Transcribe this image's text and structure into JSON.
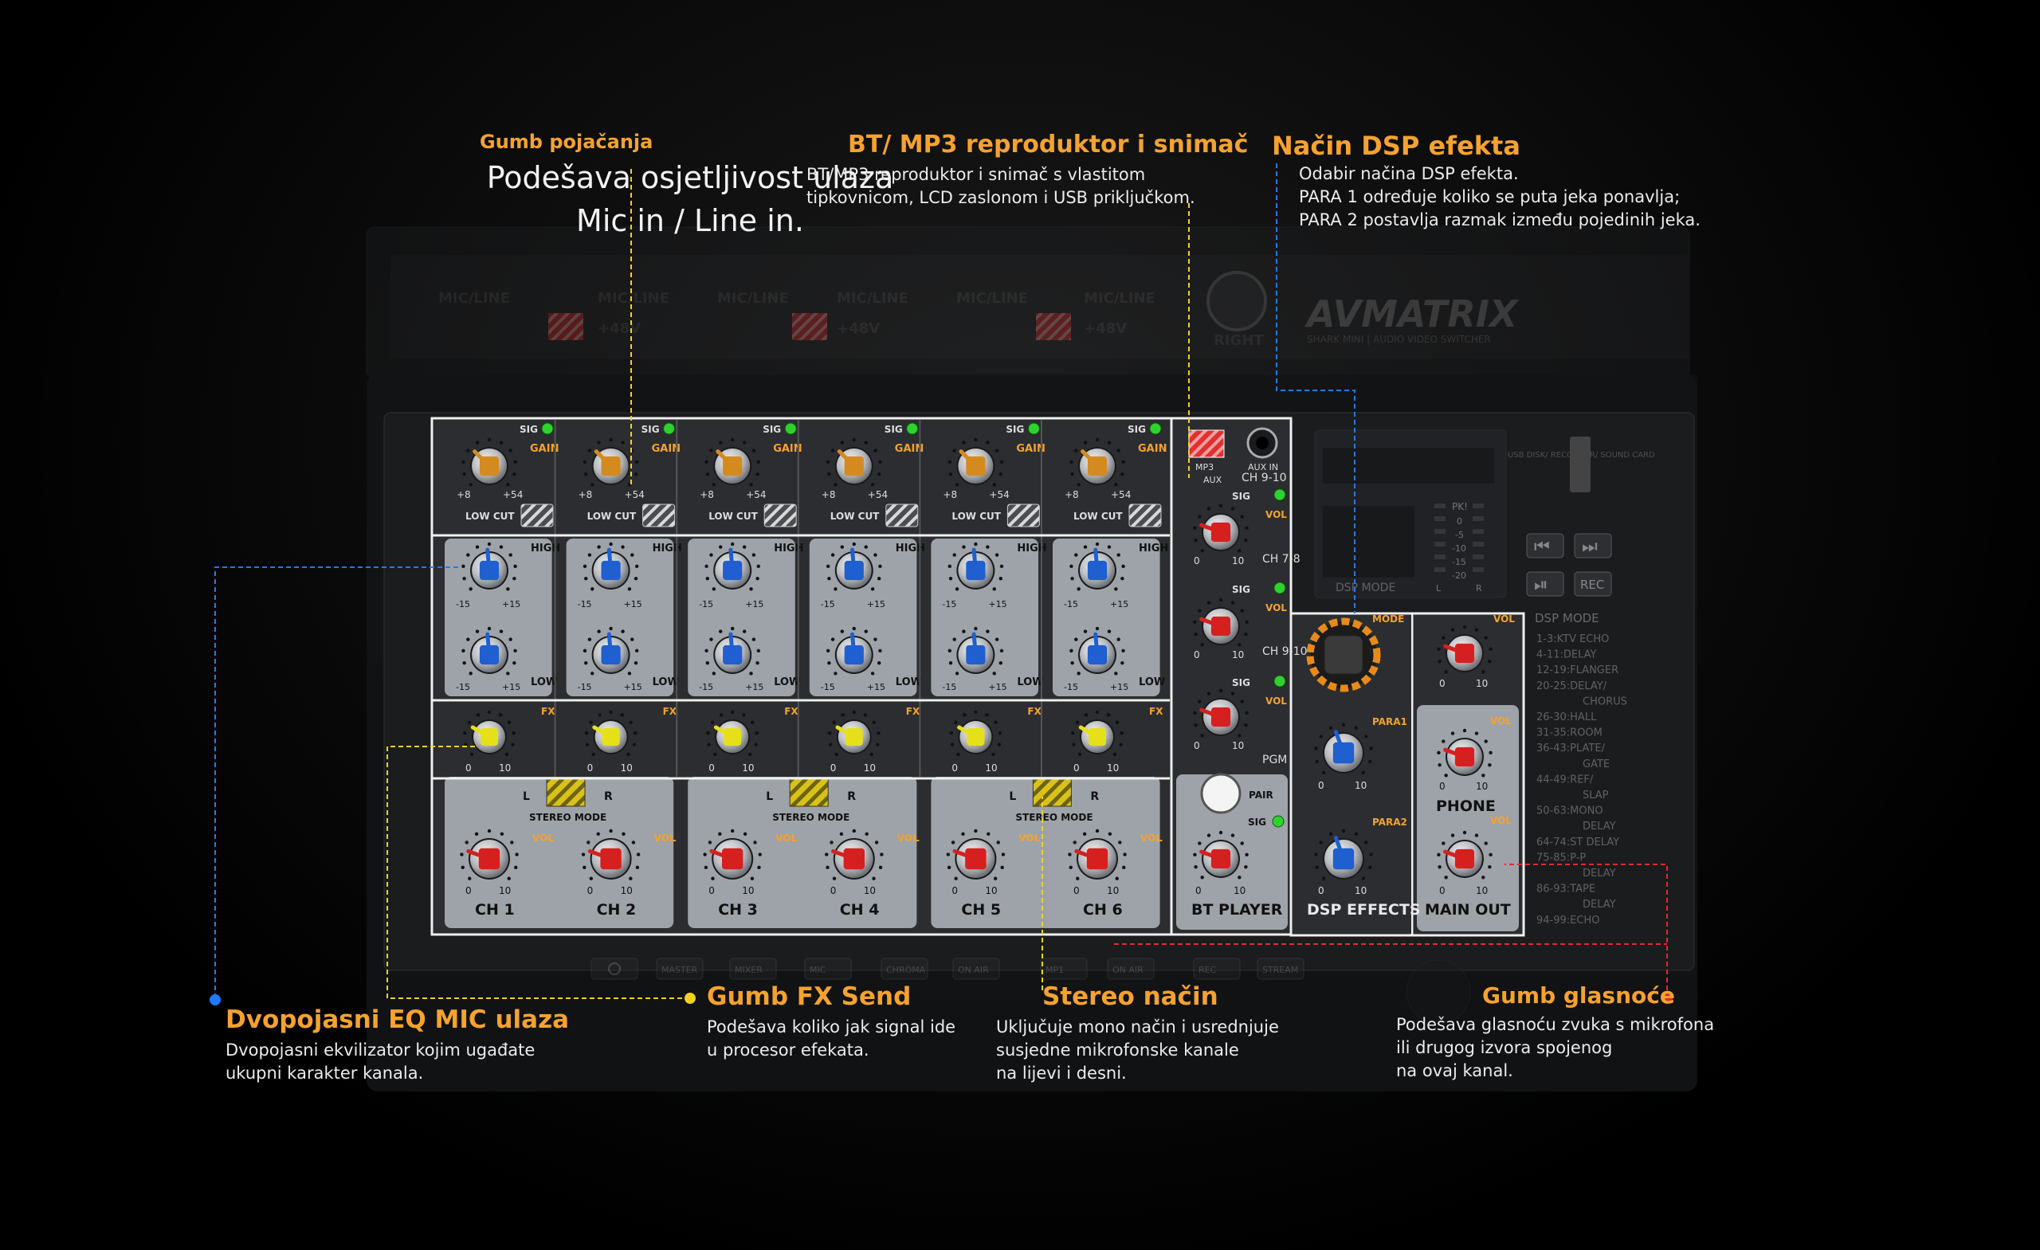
{
  "colors": {
    "accent_orange": "#f5a22f",
    "leader_yellow": "#f2d21e",
    "leader_blue": "#1e7bff",
    "leader_red": "#e8272a",
    "knob_gain": "#d48a1f",
    "knob_eq": "#1f5fcf",
    "knob_fx": "#e6e01a",
    "knob_vol": "#d62020",
    "panel_grey": "#9ea3a9",
    "panel_dark": "#2b2d30"
  },
  "annotations": {
    "gain": {
      "title": "Gumb pojačanja",
      "desc": "Podešava osjetljivost ulaza\nMic in / Line in."
    },
    "bt": {
      "title": "BT/ MP3 reproduktor i snimač",
      "desc": "BT/MP3 reproduktor i snimač s vlastitom\ntipkovnicom, LCD zaslonom i USB priključkom."
    },
    "dsp": {
      "title": "Način DSP efekta",
      "desc": "Odabir načina DSP efekta.\nPARA 1 određuje koliko se puta jeka ponavlja;\nPARA 2 postavlja razmak između pojedinih jeka."
    },
    "eq": {
      "title": "Dvopojasni EQ MIC ulaza",
      "desc": "Dvopojasni ekvilizator kojim ugađate\nukupni karakter kanala."
    },
    "fx": {
      "title": "Gumb FX Send",
      "desc": "Podešava koliko jak signal ide\nu procesor efekata."
    },
    "stereo": {
      "title": "Stereo način",
      "desc": "Uključuje mono način i usrednjuje\nsusjedne mikrofonske kanale\nna lijevi i desni."
    },
    "volume": {
      "title": "Gumb glasnoće",
      "desc": "Podešava glasnoću zvuka s mikrofona\nili drugog izvora spojenog\nna ovaj kanal."
    }
  },
  "mixer": {
    "sig": "SIG",
    "gain": "GAIN",
    "gain_min": "+8",
    "gain_max": "+54",
    "low_cut": "LOW CUT",
    "high": "HIGH",
    "low": "LOW",
    "eq_min": "-15",
    "eq_max": "+15",
    "fx": "FX",
    "vol": "VOL",
    "vol_min": "0",
    "vol_max": "10",
    "stereo_mode": "STEREO MODE",
    "left": "L",
    "right": "R",
    "channels": [
      "CH 1",
      "CH 2",
      "CH 3",
      "CH 4",
      "CH 5",
      "CH 6"
    ],
    "mp3": "MP3",
    "aux": "AUX",
    "aux_in": "AUX IN",
    "ch910": "CH 9-10",
    "ch78": "CH 7-8",
    "ch910b": "CH 9-10",
    "pgm": "PGM",
    "pair": "PAIR",
    "bt_player": "BT PLAYER",
    "mode": "MODE",
    "para1": "PARA1",
    "para2": "PARA2",
    "dsp_effects": "DSP EFFECTS",
    "phone": "PHONE",
    "main_out": "MAIN OUT",
    "dsp_mode_screen": "DSP MODE",
    "pk": "PK!",
    "meter_vals": [
      "0",
      "-5",
      "-10",
      "-15",
      "-20"
    ],
    "meter_l": "L",
    "meter_r": "R",
    "usb_label": "USB DISK/\nRECORDER/\nSOUND CARD",
    "rec": "REC",
    "dsp_mode_title": "DSP MODE",
    "dsp_list": [
      "1-3:KTV ECHO",
      "4-11:DELAY",
      "12-19:FLANGER",
      "20-25:DELAY/",
      "CHORUS",
      "26-30:HALL",
      "31-35:ROOM",
      "36-43:PLATE/",
      "GATE",
      "44-49:REF/",
      "SLAP",
      "50-63:MONO",
      "DELAY",
      "64-74:ST DELAY",
      "75-85:P-P",
      "DELAY",
      "86-93:TAPE",
      "DELAY",
      "94-99:ECHO"
    ],
    "brand": "AVMATRIX",
    "brand_sub": "SHARK MINI | AUDIO VIDEO SWITCHER",
    "mic_line": "MIC/LINE",
    "plus48": "+48V",
    "right_label": "RIGHT",
    "bottom_buttons": [
      "MASTER",
      "MIXER",
      "MIC",
      "CHROMA",
      "ON AIR",
      "MP1",
      "ON AIR",
      "REC",
      "STREAM"
    ]
  }
}
